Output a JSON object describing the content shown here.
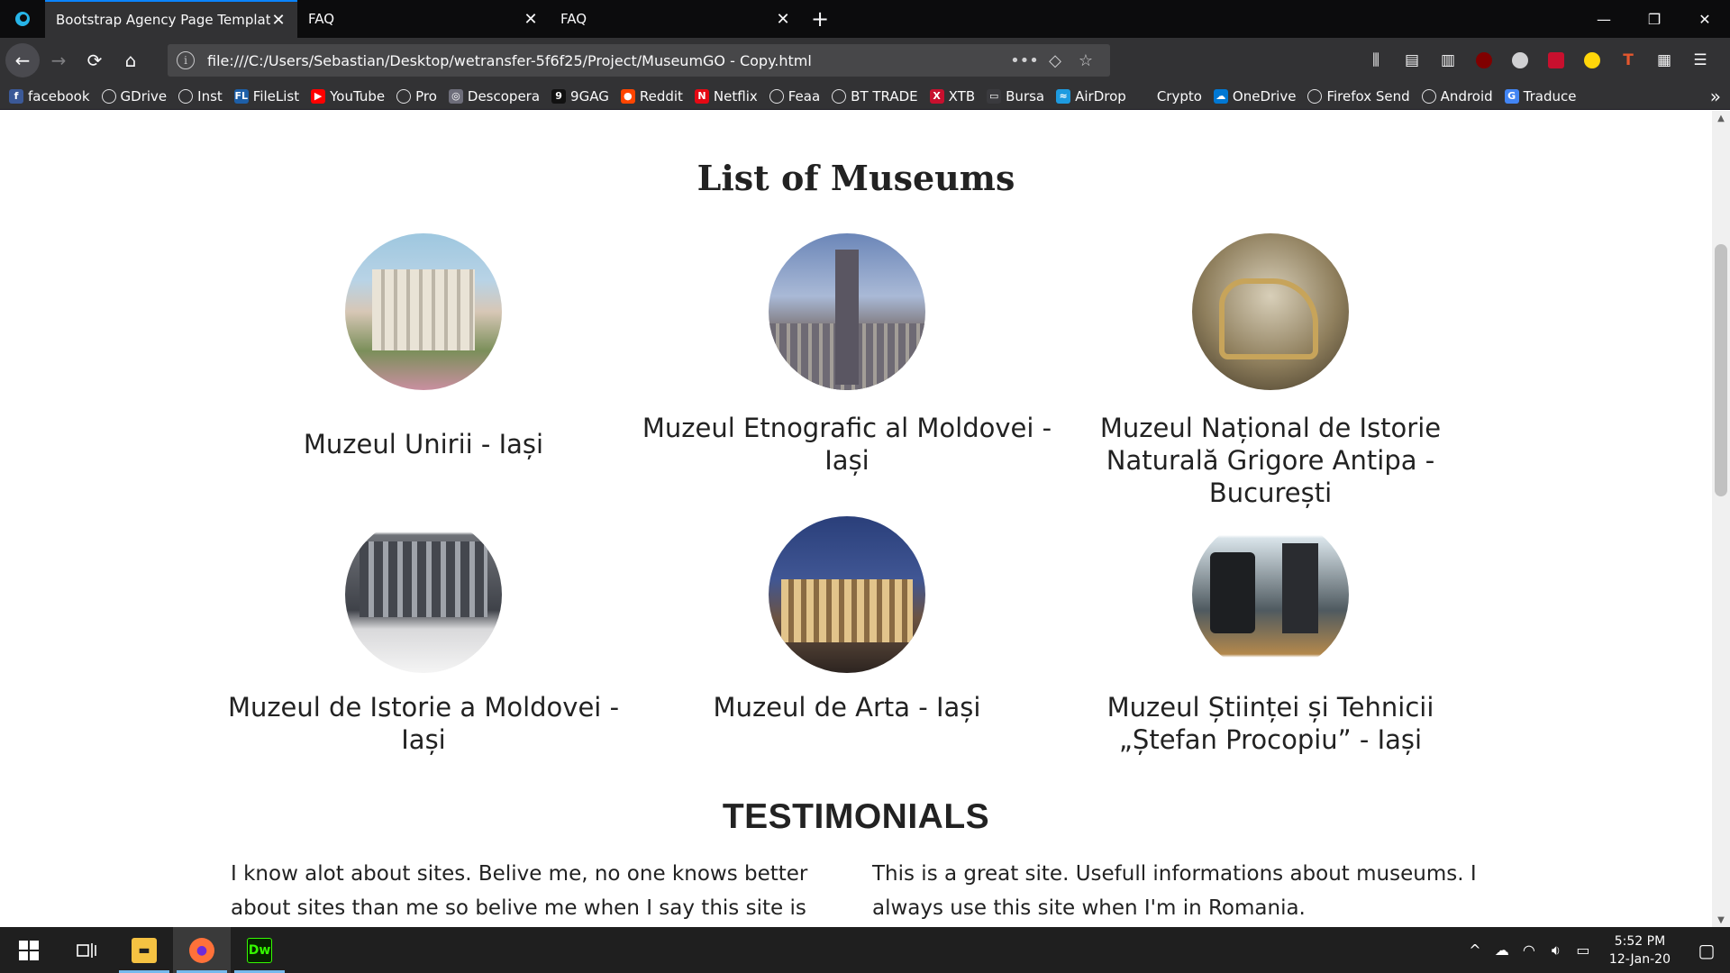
{
  "browser": {
    "tabs": [
      {
        "title": "Bootstrap Agency Page Template",
        "active": true
      },
      {
        "title": "FAQ",
        "active": false
      },
      {
        "title": "FAQ",
        "active": false
      }
    ],
    "url": "file:///C:/Users/Sebastian/Desktop/wetransfer-5f6f25/Project/MuseumGO - Copy.html",
    "icons": {
      "back": "←",
      "forward": "→",
      "reload": "⟳",
      "home": "⌂",
      "page_actions": "•••",
      "pocket": "◇",
      "bookmark": "☆",
      "close": "✕",
      "new_tab": "+",
      "minimize": "—",
      "restore": "❐",
      "window_close": "✕",
      "library": "⫼",
      "sidebar": "▤",
      "menu": "☰",
      "more": "»"
    },
    "bookmarks": [
      {
        "label": "facebook",
        "icon": "facebook-icon",
        "color": "#3b5998",
        "glyph": "f"
      },
      {
        "label": "GDrive",
        "icon": "globe-icon"
      },
      {
        "label": "Inst",
        "icon": "globe-icon"
      },
      {
        "label": "FileList",
        "icon": "filelist-icon",
        "color": "#1d5fa8",
        "glyph": "FL"
      },
      {
        "label": "YouTube",
        "icon": "youtube-icon",
        "color": "#ff0000",
        "glyph": "▶"
      },
      {
        "label": "Pro",
        "icon": "globe-icon"
      },
      {
        "label": "Descopera",
        "icon": "descopera-icon",
        "color": "#6d6d7a",
        "glyph": "◎"
      },
      {
        "label": "9GAG",
        "icon": "9gag-icon",
        "color": "#111111",
        "glyph": "9"
      },
      {
        "label": "Reddit",
        "icon": "reddit-icon",
        "color": "#ff4500",
        "glyph": "●"
      },
      {
        "label": "Netflix",
        "icon": "netflix-icon",
        "color": "#e50914",
        "glyph": "N"
      },
      {
        "label": "Feaa",
        "icon": "globe-icon"
      },
      {
        "label": "BT TRADE",
        "icon": "globe-icon"
      },
      {
        "label": "XTB",
        "icon": "xtb-icon",
        "color": "#c8102e",
        "glyph": "X"
      },
      {
        "label": "Bursa",
        "icon": "folder-icon",
        "color": "#3a3a3e",
        "glyph": "▭"
      },
      {
        "label": "AirDrop",
        "icon": "airdrop-icon",
        "color": "#1e9be0",
        "glyph": "≈"
      },
      {
        "label": "Crypto",
        "icon": "crypto-icon",
        "color": "#323234",
        "glyph": ""
      },
      {
        "label": "OneDrive",
        "icon": "onedrive-icon",
        "color": "#0078d4",
        "glyph": "☁"
      },
      {
        "label": "Firefox Send",
        "icon": "globe-icon"
      },
      {
        "label": "Android",
        "icon": "globe-icon"
      },
      {
        "label": "Traduce",
        "icon": "translate-icon",
        "color": "#4285f4",
        "glyph": "G"
      }
    ]
  },
  "page": {
    "museums_title": "List of Museums",
    "museums": [
      {
        "name": "Muzeul Unirii - Iași",
        "photo": "p-unirii"
      },
      {
        "name": "Muzeul Etnografic al Moldovei - Iași",
        "photo": "p-cultura"
      },
      {
        "name": "Muzeul Național de Istorie Naturală Grigore Antipa - București",
        "photo": "p-antipa"
      },
      {
        "name": "Muzeul de Istorie a Moldovei - Iași",
        "photo": "p-istorie"
      },
      {
        "name": "Muzeul de Arta - Iași",
        "photo": "p-arta"
      },
      {
        "name": "Muzeul Științei și Tehnicii „Ștefan Procopiu” - Iași",
        "photo": "p-stiinte"
      }
    ],
    "testimonials_title": "TESTIMONIALS",
    "testimonials": [
      "I know alot about sites. Belive me, no one knows better about sites than me so belive me when I say this site is great.",
      "This is a great site. Usefull informations about museums. I always use this site when I'm in Romania."
    ]
  },
  "taskbar": {
    "start_icon": "windows-start-icon",
    "task_view_icon": "task-view-icon",
    "apps": [
      {
        "name": "File Explorer",
        "glyph": "▬",
        "color": "#f5c242"
      },
      {
        "name": "Firefox",
        "glyph": "●",
        "color": "#ff7139"
      },
      {
        "name": "Dreamweaver",
        "glyph": "Dw",
        "color": "#35fa00"
      }
    ],
    "time": "5:52 PM",
    "date": "12-Jan-20"
  },
  "colors": {
    "tab_accent": "#0a84ff",
    "chrome_dark": "#0c0c0d",
    "toolbar": "#323234",
    "page_bg": "#ffffff",
    "text": "#222222"
  }
}
